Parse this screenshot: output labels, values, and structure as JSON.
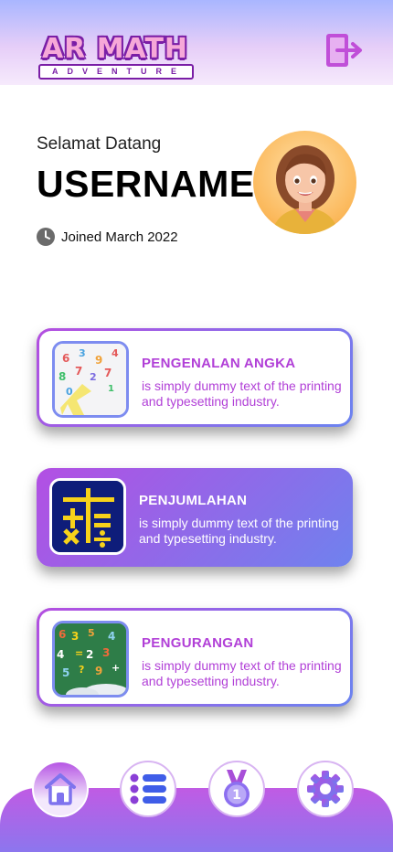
{
  "header": {
    "logo_title": "AR MATH",
    "logo_subtitle": "ADVENTURE",
    "logout_icon": "logout-icon"
  },
  "profile": {
    "greeting": "Selamat Datang",
    "username": "USERNAME",
    "joined": "Joined March 2022",
    "avatar_icon": "avatar-girl"
  },
  "menu": {
    "cards": [
      {
        "title": "PENGENALAN ANGKA",
        "description": "is simply dummy text of the printing and typesetting industry.",
        "icon": "numbers-thumbnail",
        "style": "outline"
      },
      {
        "title": "PENJUMLAHAN",
        "description": "is simply dummy text of the printing and typesetting industry.",
        "icon": "math-symbols-thumbnail",
        "style": "filled"
      },
      {
        "title": "PENGURANGAN",
        "description": "is simply dummy text of the printing and typesetting industry.",
        "icon": "chalkboard-numbers-thumbnail",
        "style": "outline"
      }
    ]
  },
  "bottom_nav": {
    "items": [
      {
        "icon": "home-icon",
        "active": true
      },
      {
        "icon": "list-icon",
        "active": false
      },
      {
        "icon": "medal-icon",
        "active": false
      },
      {
        "icon": "gear-icon",
        "active": false
      }
    ],
    "medal_number": "1"
  },
  "colors": {
    "accent_purple": "#b13fd7",
    "accent_blue": "#6f82ee",
    "header_gradient_top": "#a9b6ff"
  }
}
